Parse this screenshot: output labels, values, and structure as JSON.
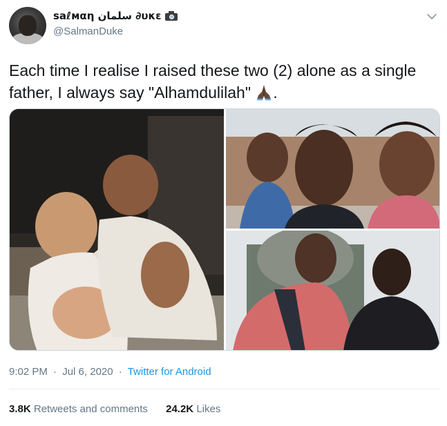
{
  "user": {
    "display_name": "saℓмαη سلمان ∂υκε",
    "handle": "@SalmanDuke",
    "avatar_icon": "profile-photo",
    "name_emoji_icon": "camera-with-flash-icon"
  },
  "menu": {
    "icon": "chevron-down-icon"
  },
  "tweet": {
    "text": "Each time I realise I raised these two (2) alone as a single father, I always say \"Alhamdulilah\"",
    "emoji_icon": "folded-hands-icon",
    "trailing": "."
  },
  "media": {
    "photos": [
      {
        "name": "photo-babies"
      },
      {
        "name": "photo-selfie-family"
      },
      {
        "name": "photo-kids-school"
      }
    ]
  },
  "meta": {
    "time": "9:02 PM",
    "separator_1": "·",
    "date": "Jul 6, 2020",
    "separator_2": "·",
    "source": "Twitter for Android"
  },
  "stats": {
    "retweets_count": "3.8K",
    "retweets_label": "Retweets and comments",
    "likes_count": "24.2K",
    "likes_label": "Likes"
  },
  "colors": {
    "text": "#14171a",
    "secondary": "#657786",
    "link": "#1b95e0",
    "border": "#e6ecf0"
  }
}
